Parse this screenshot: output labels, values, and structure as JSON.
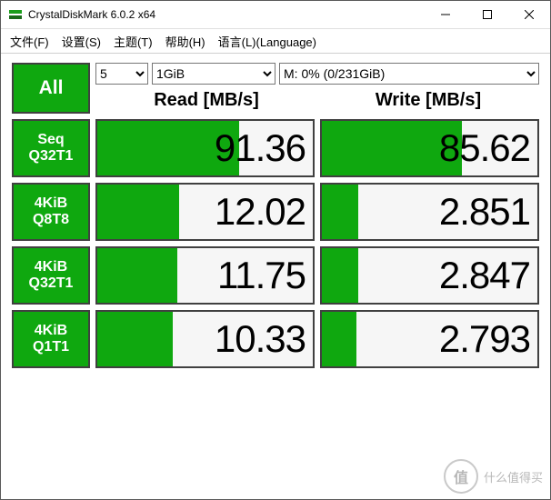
{
  "window": {
    "title": "CrystalDiskMark 6.0.2 x64"
  },
  "menu": {
    "file": "文件(F)",
    "settings": "设置(S)",
    "theme": "主题(T)",
    "help": "帮助(H)",
    "language": "语言(L)(Language)"
  },
  "controls": {
    "all": "All",
    "count": "5",
    "size": "1GiB",
    "drive": "M: 0% (0/231GiB)"
  },
  "headers": {
    "read": "Read [MB/s]",
    "write": "Write [MB/s]"
  },
  "rows": [
    {
      "l1": "Seq",
      "l2": "Q32T1",
      "read": "91.36",
      "rpct": 66,
      "write": "85.62",
      "wpct": 65
    },
    {
      "l1": "4KiB",
      "l2": "Q8T8",
      "read": "12.02",
      "rpct": 38,
      "write": "2.851",
      "wpct": 17
    },
    {
      "l1": "4KiB",
      "l2": "Q32T1",
      "read": "11.75",
      "rpct": 37,
      "write": "2.847",
      "wpct": 17
    },
    {
      "l1": "4KiB",
      "l2": "Q1T1",
      "read": "10.33",
      "rpct": 35,
      "write": "2.793",
      "wpct": 16
    }
  ],
  "watermark": {
    "badge": "值",
    "text": "什么值得买"
  }
}
